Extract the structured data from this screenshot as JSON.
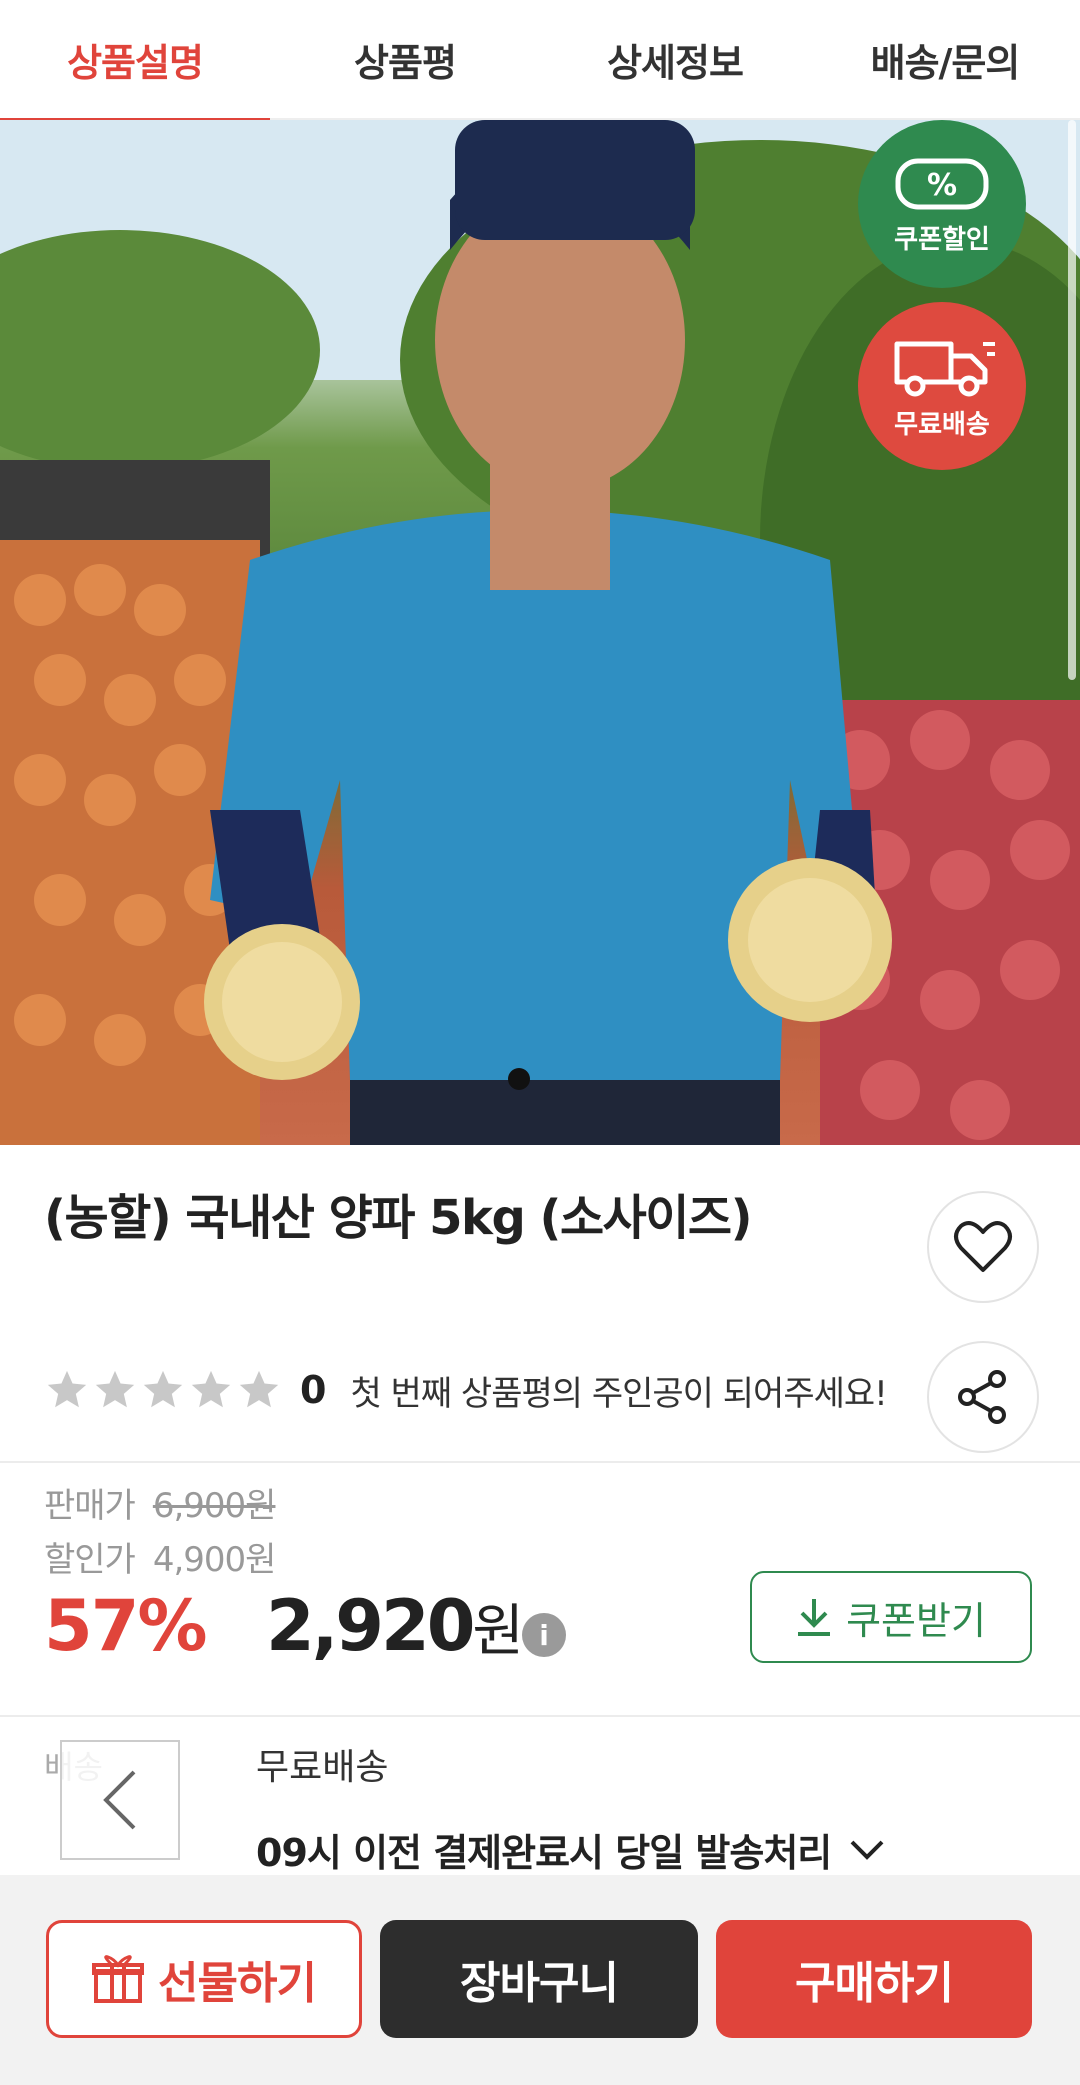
{
  "tabs": [
    {
      "label": "상품설명",
      "active": true
    },
    {
      "label": "상품평",
      "active": false
    },
    {
      "label": "상세정보",
      "active": false
    },
    {
      "label": "배송/문의",
      "active": false
    }
  ],
  "badges": {
    "coupon": {
      "label": "쿠폰할인",
      "icon": "percent-coupon-icon",
      "glyph": "%"
    },
    "free_shipping": {
      "label": "무료배송",
      "icon": "delivery-truck-icon"
    }
  },
  "product": {
    "title": "(농할) 국내산 양파 5kg (소사이즈)",
    "rating": {
      "stars": 0,
      "max_stars": 5,
      "count": "0",
      "message": "첫 번째 상품평의 주인공이 되어주세요!"
    }
  },
  "pricing": {
    "sale_label": "판매가",
    "sale_price": "6,900원",
    "discount_label": "할인가",
    "discount_price": "4,900원",
    "discount_percent": "57%",
    "final_price": "2,920",
    "currency": "원",
    "info_glyph": "i",
    "coupon_button": "쿠폰받기"
  },
  "shipping": {
    "label": "배송",
    "type": "무료배송",
    "note": "09시 이전 결제완료시 당일 발송처리"
  },
  "actions": {
    "gift": "선물하기",
    "cart": "장바구니",
    "buy": "구매하기"
  },
  "colors": {
    "accent": "#e0443b",
    "coupon_green": "#2f8a4f",
    "dark": "#2d2d2d"
  }
}
